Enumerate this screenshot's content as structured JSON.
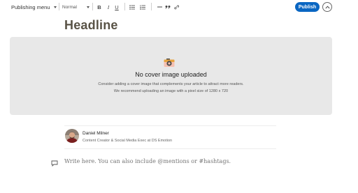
{
  "toolbar": {
    "publishing_menu": "Publishing menu",
    "text_style": "Normal",
    "bold": "B",
    "italic": "I",
    "underline": "U",
    "publish_label": "Publish"
  },
  "editor": {
    "headline": "Headline",
    "cover": {
      "title": "No cover image uploaded",
      "description_line1": "Consider adding a cover image that complements your article to attract more readers.",
      "description_line2": "We recommend uploading an image with a pixel size of 1280 x 720"
    },
    "author": {
      "name": "Daniel Milner",
      "title": "Content Creator & Social Media Exec at DS Emotion"
    },
    "body_placeholder": "Write here. You can also include @mentions or #hashtags."
  },
  "colors": {
    "publish_button": "#0a66c2",
    "headline_text": "#595346",
    "cover_background": "#e8e8e8",
    "camera_icon_orange": "#e7a33e",
    "camera_icon_pink": "#f5c0b0",
    "camera_icon_dark": "#4a4a4a"
  }
}
